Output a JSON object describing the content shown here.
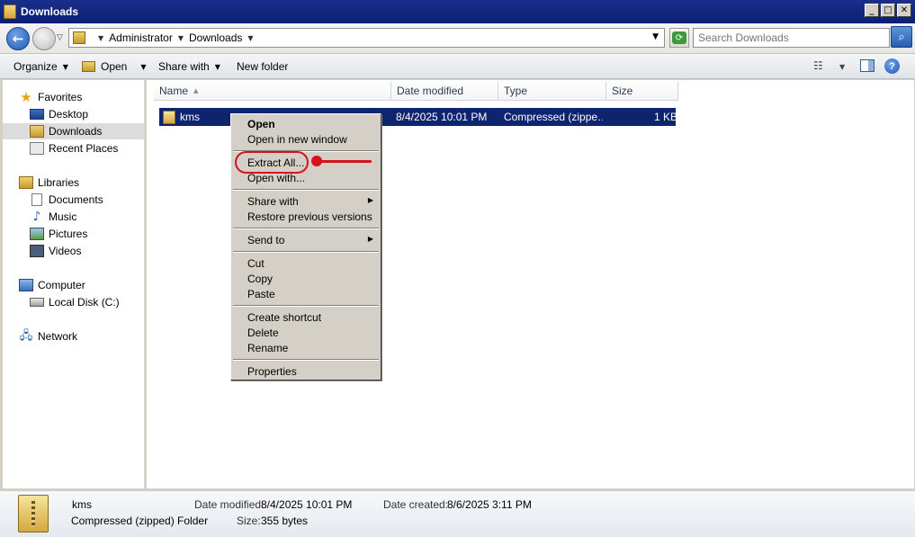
{
  "window": {
    "title": "Downloads",
    "controls": {
      "minimize": "_",
      "maximize": "□",
      "close": "✕"
    }
  },
  "address_bar": {
    "crumbs": [
      "Administrator",
      "Downloads"
    ],
    "search_placeholder": "Search Downloads"
  },
  "toolbar": {
    "organize": "Organize",
    "open": "Open",
    "share_with": "Share with",
    "new_folder": "New folder"
  },
  "nav_pane": {
    "favorites": {
      "label": "Favorites",
      "items": [
        "Desktop",
        "Downloads",
        "Recent Places"
      ]
    },
    "libraries": {
      "label": "Libraries",
      "items": [
        "Documents",
        "Music",
        "Pictures",
        "Videos"
      ]
    },
    "computer": {
      "label": "Computer",
      "items": [
        "Local Disk (C:)"
      ]
    },
    "network": {
      "label": "Network"
    }
  },
  "file_list": {
    "columns": [
      "Name",
      "Date modified",
      "Type",
      "Size"
    ],
    "rows": [
      {
        "name": "kms",
        "date_modified": "8/4/2025 10:01 PM",
        "type": "Compressed (zippe…",
        "size": "1 KB"
      }
    ]
  },
  "context_menu": {
    "items": [
      "Open",
      "Open in new window",
      "Extract All...",
      "Open with...",
      "Share with",
      "Restore previous versions",
      "Send to",
      "Cut",
      "Copy",
      "Paste",
      "Create shortcut",
      "Delete",
      "Rename",
      "Properties"
    ]
  },
  "details_pane": {
    "name": "kms",
    "kind": "Compressed (zipped) Folder",
    "date_modified_label": "Date modified:",
    "date_modified": "8/4/2025 10:01 PM",
    "date_created_label": "Date created:",
    "date_created": "8/6/2025 3:11 PM",
    "size_label": "Size:",
    "size": "355 bytes"
  },
  "colors": {
    "title_bar": "#0b1f74",
    "selection": "#0f246e",
    "annotation": "#d8121c",
    "menu_bg": "#d4d0c8"
  }
}
